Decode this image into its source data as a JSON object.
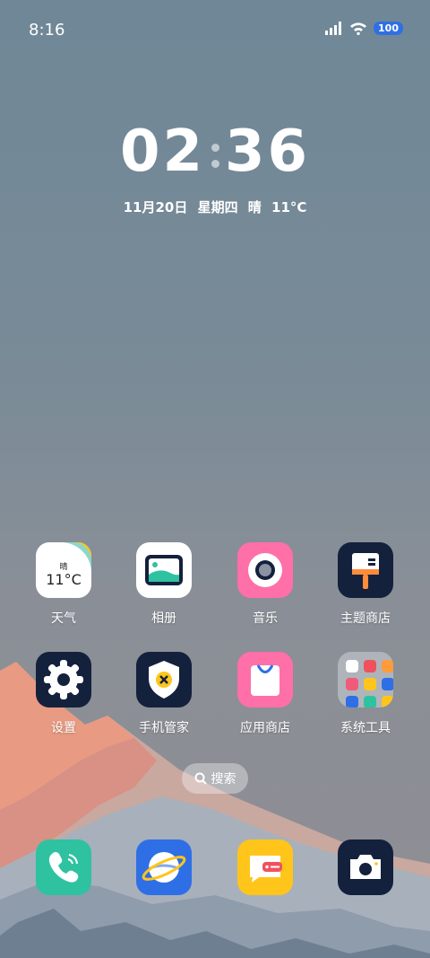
{
  "status_bar": {
    "time": "8:16",
    "battery": "100"
  },
  "clock": {
    "hours": "02",
    "minutes": "36",
    "date_line": "11月20日 星期四 晴 11°C"
  },
  "apps": {
    "weather": {
      "label": "天气",
      "condition": "晴",
      "temp": "11°C"
    },
    "gallery": {
      "label": "相册"
    },
    "music": {
      "label": "音乐"
    },
    "themes": {
      "label": "主题商店"
    },
    "settings": {
      "label": "设置"
    },
    "phone_manager": {
      "label": "手机管家"
    },
    "app_store": {
      "label": "应用商店"
    },
    "system_tools": {
      "label": "系统工具"
    }
  },
  "search": {
    "label": "搜索"
  },
  "dock": {
    "items": [
      "phone-icon",
      "browser-icon",
      "messages-icon",
      "camera-icon"
    ]
  },
  "colors": {
    "accent_blue": "#2f6fe6",
    "teal": "#2fc2a0",
    "pink": "#ff6fa8",
    "navy": "#14213d",
    "yellow": "#ffc51a"
  }
}
